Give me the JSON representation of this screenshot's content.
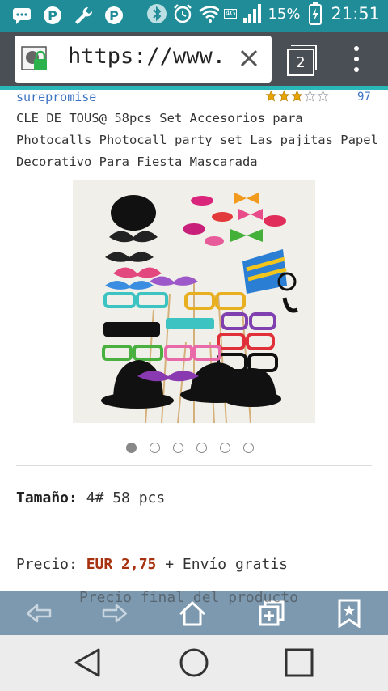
{
  "status_bar": {
    "left_icons": [
      "chat-bubble-icon",
      "pinterest-icon",
      "wrench-icon",
      "pinterest-icon"
    ],
    "right_icons": [
      "bluetooth-icon",
      "alarm-icon",
      "wifi-icon",
      "signal-icon",
      "battery-charging-icon"
    ],
    "network": "4G",
    "battery": "15%",
    "time": "21:51"
  },
  "browser": {
    "url": "https://www.a",
    "tab_count": "2",
    "colors": {
      "status_bar": "#1f8c98",
      "toolbar": "#4a4f55",
      "progress": "#2ab7b8"
    }
  },
  "product": {
    "seller": "surepromise",
    "rating": 3,
    "rating_max": 5,
    "review_count": "97",
    "title": "CLE DE TOUS@ 58pcs Set Accesorios para Photocalls Photocall party set Las pajitas Papel Decorativo Para Fiesta Mascarada",
    "image_count": 6,
    "active_image": 0,
    "size_label": "Tamaño:",
    "size_value": "4# 58 pcs",
    "price_label": "Precio:",
    "price_value": "EUR 2,75",
    "shipping": "+ Envío gratis",
    "price_note": "Precio final del producto"
  },
  "bottom_toolbar": {
    "icons": [
      "back-arrow-icon",
      "forward-arrow-icon",
      "home-icon",
      "add-tab-icon",
      "bookmark-icon"
    ]
  },
  "nav_bar": {
    "icons": [
      "nav-back-icon",
      "nav-home-icon",
      "nav-recents-icon"
    ]
  }
}
